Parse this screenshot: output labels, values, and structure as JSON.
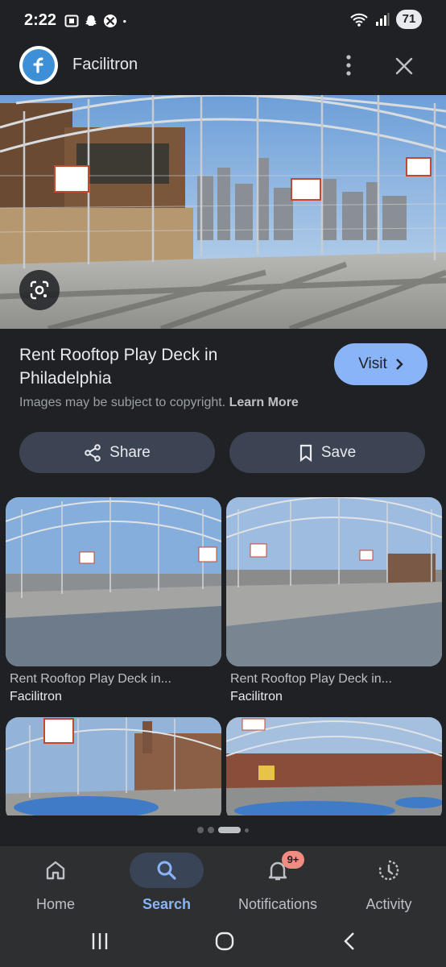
{
  "status_bar": {
    "time": "2:22",
    "battery": "71",
    "left_icons": [
      "screenshot-icon",
      "snapchat-icon",
      "xbox-icon",
      "dot-icon"
    ],
    "right_icons": [
      "wifi-icon",
      "signal-icon"
    ]
  },
  "header": {
    "site_name": "Facilitron",
    "logo_letter": "f",
    "icons": [
      "more-vert-icon",
      "close-icon"
    ]
  },
  "result": {
    "title": "Rent Rooftop Play Deck in Philadelphia",
    "visit_label": "Visit",
    "copyright_text": "Images may be subject to copyright.",
    "learn_more": "Learn More"
  },
  "actions": {
    "share_label": "Share",
    "save_label": "Save"
  },
  "related": [
    {
      "title": "Rent Rooftop Play Deck in...",
      "source": "Facilitron"
    },
    {
      "title": "Rent Rooftop Play Deck in...",
      "source": "Facilitron"
    },
    {
      "title": "",
      "source": ""
    },
    {
      "title": "",
      "source": ""
    }
  ],
  "bottom_nav": {
    "items": [
      {
        "label": "Home",
        "icon": "home-icon"
      },
      {
        "label": "Search",
        "icon": "search-icon",
        "active": true
      },
      {
        "label": "Notifications",
        "icon": "bell-icon",
        "badge": "9+"
      },
      {
        "label": "Activity",
        "icon": "activity-icon"
      }
    ]
  },
  "colors": {
    "background": "#202124",
    "accent": "#8ab4f8",
    "pill": "#3c4453",
    "badge": "#f28b82"
  }
}
